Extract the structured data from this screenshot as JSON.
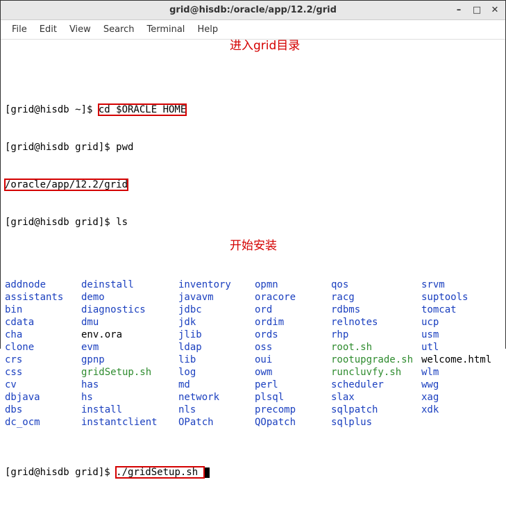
{
  "window": {
    "title": "grid@hisdb:/oracle/app/12.2/grid",
    "controls": {
      "min": "–",
      "max": "□",
      "close": "✕"
    }
  },
  "menu": {
    "file": "File",
    "edit": "Edit",
    "view": "View",
    "search": "Search",
    "terminal": "Terminal",
    "help": "Help"
  },
  "prompts": {
    "line1_prompt": "[grid@hisdb ~]$ ",
    "line1_cmd": "cd $ORACLE_HOME",
    "line2_prompt": "[grid@hisdb grid]$ ",
    "line2_cmd": "pwd",
    "line3_output": "/oracle/app/12.2/grid",
    "line4_prompt": "[grid@hisdb grid]$ ",
    "line4_cmd": "ls",
    "lineN_prompt": "[grid@hisdb grid]$ ",
    "lineN_cmd": "./gridSetup.sh "
  },
  "annotations": {
    "a1": "进入grid目录",
    "a2": "开始安装"
  },
  "ls_rows": [
    [
      {
        "t": "addnode",
        "c": "dir-blue"
      },
      {
        "t": "deinstall",
        "c": "dir-blue"
      },
      {
        "t": "inventory",
        "c": "dir-blue"
      },
      {
        "t": "opmn",
        "c": "dir-blue"
      },
      {
        "t": "qos",
        "c": "dir-blue"
      },
      {
        "t": "srvm",
        "c": "dir-blue"
      }
    ],
    [
      {
        "t": "assistants",
        "c": "dir-blue"
      },
      {
        "t": "demo",
        "c": "dir-blue"
      },
      {
        "t": "javavm",
        "c": "dir-blue"
      },
      {
        "t": "oracore",
        "c": "dir-blue"
      },
      {
        "t": "racg",
        "c": "dir-blue"
      },
      {
        "t": "suptools",
        "c": "dir-blue"
      }
    ],
    [
      {
        "t": "bin",
        "c": "dir-blue"
      },
      {
        "t": "diagnostics",
        "c": "dir-blue"
      },
      {
        "t": "jdbc",
        "c": "dir-blue"
      },
      {
        "t": "ord",
        "c": "dir-blue"
      },
      {
        "t": "rdbms",
        "c": "dir-blue"
      },
      {
        "t": "tomcat",
        "c": "dir-blue"
      }
    ],
    [
      {
        "t": "cdata",
        "c": "dir-blue"
      },
      {
        "t": "dmu",
        "c": "dir-blue"
      },
      {
        "t": "jdk",
        "c": "dir-blue"
      },
      {
        "t": "ordim",
        "c": "dir-blue"
      },
      {
        "t": "relnotes",
        "c": "dir-blue"
      },
      {
        "t": "ucp",
        "c": "dir-blue"
      }
    ],
    [
      {
        "t": "cha",
        "c": "dir-blue"
      },
      {
        "t": "env.ora",
        "c": "file-black"
      },
      {
        "t": "jlib",
        "c": "dir-blue"
      },
      {
        "t": "ords",
        "c": "dir-blue"
      },
      {
        "t": "rhp",
        "c": "dir-blue"
      },
      {
        "t": "usm",
        "c": "dir-blue"
      }
    ],
    [
      {
        "t": "clone",
        "c": "dir-blue"
      },
      {
        "t": "evm",
        "c": "dir-blue"
      },
      {
        "t": "ldap",
        "c": "dir-blue"
      },
      {
        "t": "oss",
        "c": "dir-blue"
      },
      {
        "t": "root.sh",
        "c": "exec-green"
      },
      {
        "t": "utl",
        "c": "dir-blue"
      }
    ],
    [
      {
        "t": "crs",
        "c": "dir-blue"
      },
      {
        "t": "gpnp",
        "c": "dir-blue"
      },
      {
        "t": "lib",
        "c": "dir-blue"
      },
      {
        "t": "oui",
        "c": "dir-blue"
      },
      {
        "t": "rootupgrade.sh",
        "c": "exec-green"
      },
      {
        "t": "welcome.html",
        "c": "file-black"
      }
    ],
    [
      {
        "t": "css",
        "c": "dir-blue"
      },
      {
        "t": "gridSetup.sh",
        "c": "exec-green"
      },
      {
        "t": "log",
        "c": "dir-blue"
      },
      {
        "t": "owm",
        "c": "dir-blue"
      },
      {
        "t": "runcluvfy.sh",
        "c": "exec-green"
      },
      {
        "t": "wlm",
        "c": "dir-blue"
      }
    ],
    [
      {
        "t": "cv",
        "c": "dir-blue"
      },
      {
        "t": "has",
        "c": "dir-blue"
      },
      {
        "t": "md",
        "c": "dir-blue"
      },
      {
        "t": "perl",
        "c": "dir-blue"
      },
      {
        "t": "scheduler",
        "c": "dir-blue"
      },
      {
        "t": "wwg",
        "c": "dir-blue"
      }
    ],
    [
      {
        "t": "dbjava",
        "c": "dir-blue"
      },
      {
        "t": "hs",
        "c": "dir-blue"
      },
      {
        "t": "network",
        "c": "dir-blue"
      },
      {
        "t": "plsql",
        "c": "dir-blue"
      },
      {
        "t": "slax",
        "c": "dir-blue"
      },
      {
        "t": "xag",
        "c": "dir-blue"
      }
    ],
    [
      {
        "t": "dbs",
        "c": "dir-blue"
      },
      {
        "t": "install",
        "c": "dir-blue"
      },
      {
        "t": "nls",
        "c": "dir-blue"
      },
      {
        "t": "precomp",
        "c": "dir-blue"
      },
      {
        "t": "sqlpatch",
        "c": "dir-blue"
      },
      {
        "t": "xdk",
        "c": "dir-blue"
      }
    ],
    [
      {
        "t": "dc_ocm",
        "c": "dir-blue"
      },
      {
        "t": "instantclient",
        "c": "dir-blue"
      },
      {
        "t": "OPatch",
        "c": "dir-blue"
      },
      {
        "t": "QOpatch",
        "c": "dir-blue"
      },
      {
        "t": "sqlplus",
        "c": "dir-blue"
      },
      {
        "t": "",
        "c": "file-black"
      }
    ]
  ]
}
